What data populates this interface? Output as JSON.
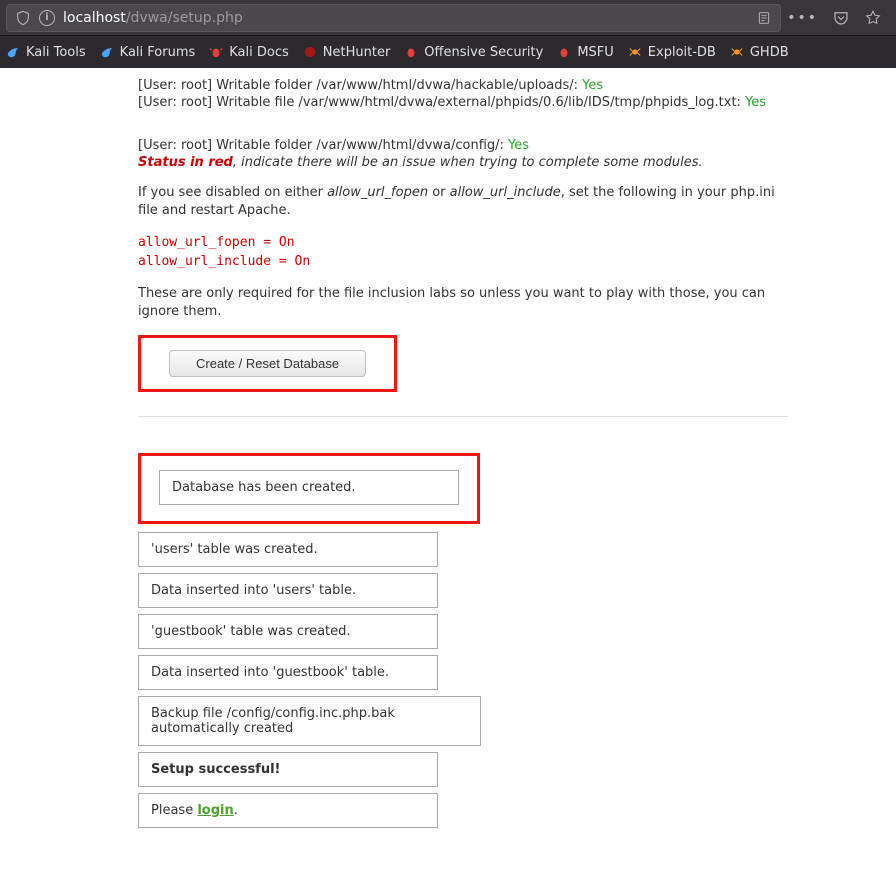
{
  "browser": {
    "url_host": "localhost",
    "url_path": "/dvwa/setup.php"
  },
  "bookmarks": [
    {
      "label": "Kali Tools",
      "color": "blue"
    },
    {
      "label": "Kali Forums",
      "color": "blue"
    },
    {
      "label": "Kali Docs",
      "color": "red"
    },
    {
      "label": "NetHunter",
      "color": "darkred"
    },
    {
      "label": "Offensive Security",
      "color": "red"
    },
    {
      "label": "MSFU",
      "color": "red"
    },
    {
      "label": "Exploit-DB",
      "color": "orange"
    },
    {
      "label": "GHDB",
      "color": "orange"
    }
  ],
  "checks": {
    "line1_pre": "[User: root] Writable folder /var/www/html/dvwa/hackable/uploads/: ",
    "line1_val": "Yes",
    "line2_pre": "[User: root] Writable file /var/www/html/dvwa/external/phpids/0.6/lib/IDS/tmp/phpids_log.txt: ",
    "line2_val": "Yes",
    "line3_pre": "[User: root] Writable folder /var/www/html/dvwa/config/: ",
    "line3_val": "Yes",
    "status_label": "Status in red",
    "status_tail": ", indicate there will be an issue when trying to complete some modules.",
    "para1_pre": "If you see disabled on either ",
    "fopen": "allow_url_fopen",
    "para1_mid": " or ",
    "finclude": "allow_url_include",
    "para1_tail": ", set the following in your php.ini file and restart Apache.",
    "code": "allow_url_fopen = On\nallow_url_include = On",
    "para2": "These are only required for the file inclusion labs so unless you want to play with those, you can ignore them."
  },
  "button_label": "Create / Reset Database",
  "messages": [
    "Database has been created.",
    "'users' table was created.",
    "Data inserted into 'users' table.",
    "'guestbook' table was created.",
    "Data inserted into 'guestbook' table.",
    "Backup file /config/config.inc.php.bak automatically created",
    "Setup successful!",
    "Please "
  ],
  "login_label": "login",
  "login_tail": "."
}
